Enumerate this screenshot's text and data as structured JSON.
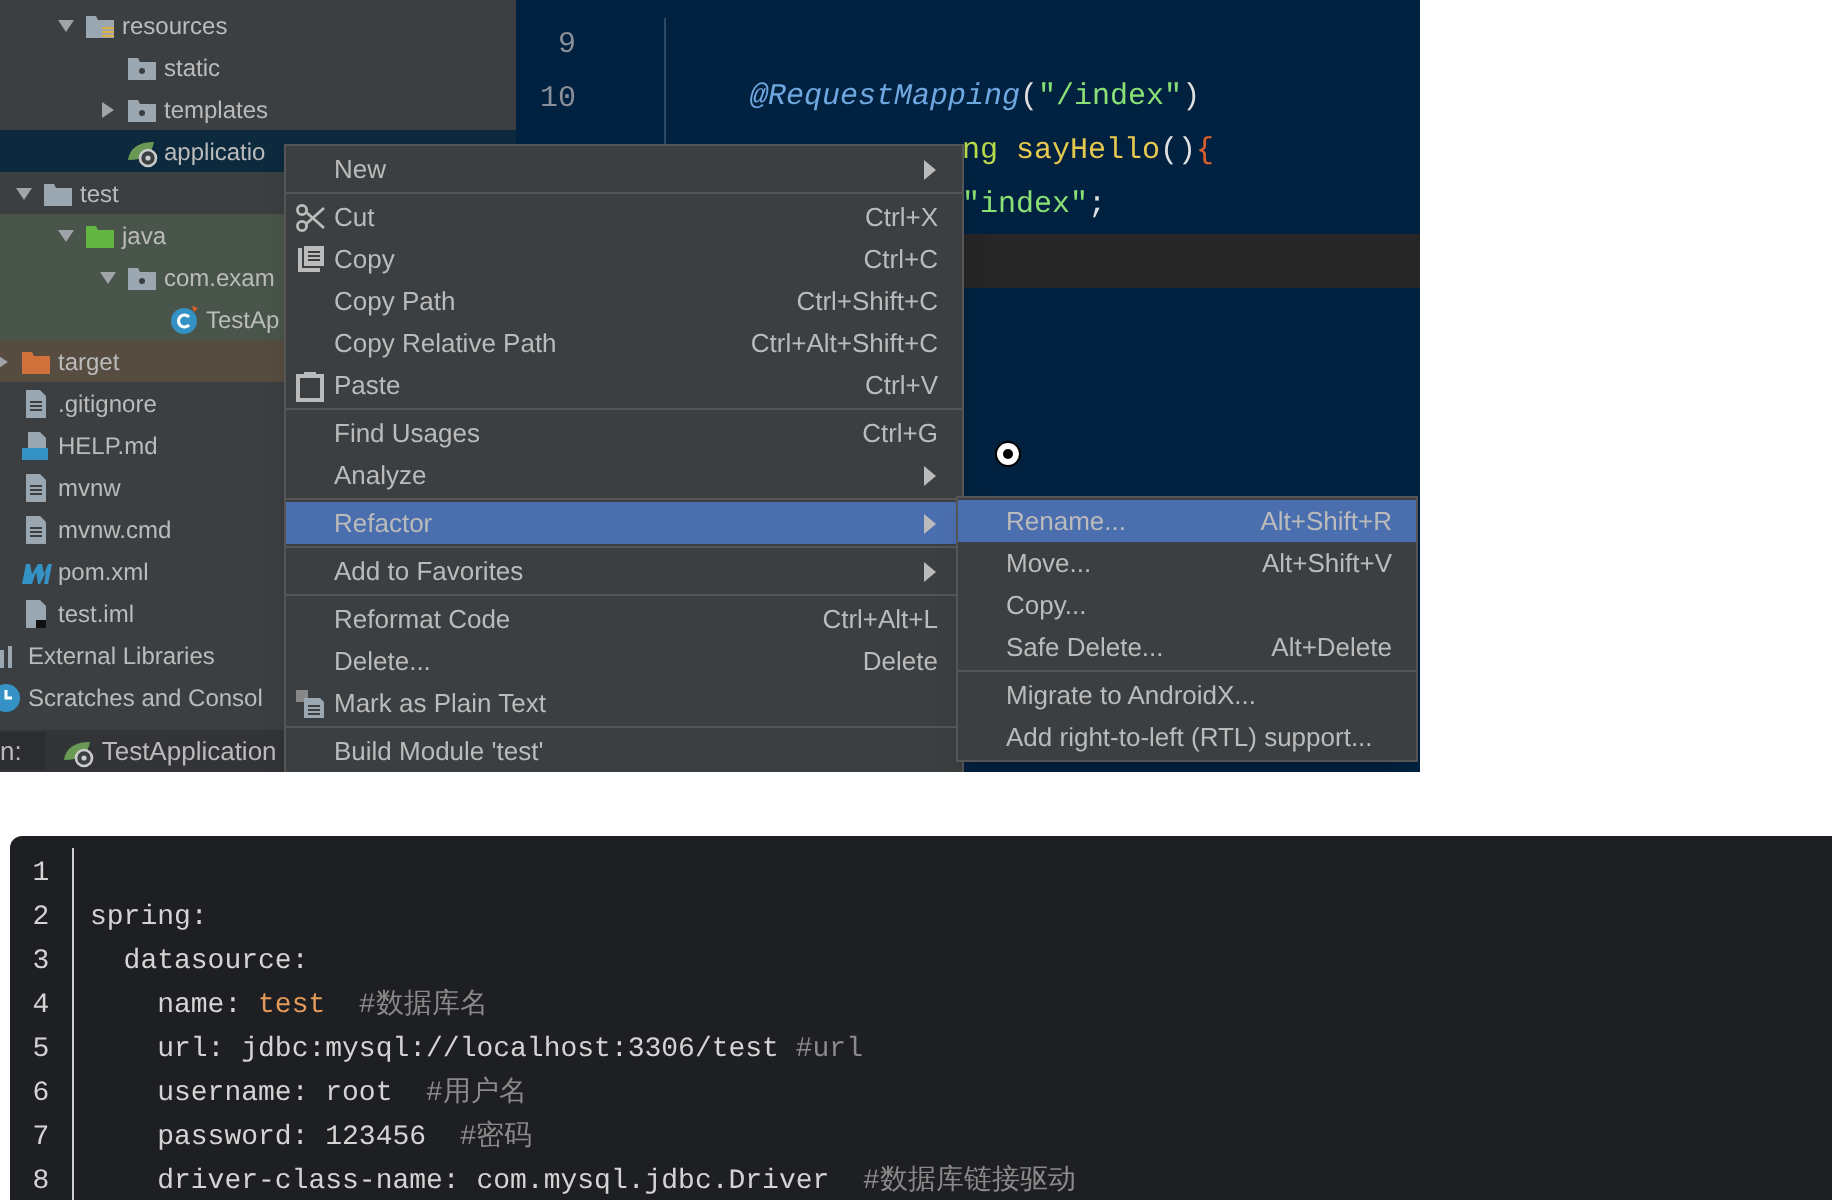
{
  "project_tree": [
    {
      "kind": "offscreen",
      "children": [
        {
          "kind": "offscreen",
          "children": [
            {
              "label": "resources",
              "kind": "resource-folder",
              "expanded": true,
              "selected": false,
              "children": [
                {
                  "label": "static",
                  "kind": "package",
                  "selected": false
                },
                {
                  "label": "templates",
                  "kind": "package",
                  "expanded": false,
                  "selected": false
                },
                {
                  "label": "applicatio",
                  "kind": "spring-config",
                  "selected": true
                }
              ]
            }
          ]
        },
        {
          "label": "test",
          "kind": "folder",
          "expanded": true,
          "selected": false,
          "children": [
            {
              "label": "java",
              "kind": "source-folder",
              "expanded": true,
              "selected": false,
              "color": "#49544a",
              "children": [
                {
                  "label": "com.exam",
                  "kind": "package",
                  "expanded": true,
                  "selected": false,
                  "color": "#49544a",
                  "children": [
                    {
                      "label": "TestAp",
                      "kind": "java-class",
                      "selected": false,
                      "color": "#49544a"
                    }
                  ]
                }
              ]
            }
          ]
        }
      ]
    },
    {
      "label": "target",
      "kind": "excluded-folder",
      "expanded": false,
      "selected": false,
      "color": "#574c40"
    },
    {
      "label": ".gitignore",
      "kind": "file",
      "selected": false
    },
    {
      "label": "HELP.md",
      "kind": "markdown",
      "selected": false
    },
    {
      "label": "mvnw",
      "kind": "file",
      "selected": false
    },
    {
      "label": "mvnw.cmd",
      "kind": "file",
      "selected": false
    },
    {
      "label": "pom.xml",
      "kind": "maven",
      "selected": false
    },
    {
      "label": "test.iml",
      "kind": "module-file",
      "selected": false
    },
    {
      "label": "External Libraries",
      "kind": "libraries",
      "selected": false
    },
    {
      "label": "Scratches and Consol",
      "kind": "scratches",
      "selected": false
    }
  ],
  "run_bar": {
    "label": "n:",
    "config": "TestApplication"
  },
  "editor": {
    "lines": [
      {
        "number": "9",
        "kind": "full"
      },
      {
        "number": "10",
        "kind": "full",
        "tokens": [
          {
            "kind": "annotation",
            "text": "@RequestMapping"
          },
          {
            "kind": "plain",
            "text": "("
          },
          {
            "kind": "string",
            "text": "\"/index\""
          },
          {
            "kind": "plain",
            "text": ")"
          }
        ]
      },
      {
        "kind": "clipped",
        "tokens": [
          {
            "kind": "type",
            "text": "ng"
          },
          {
            "kind": "method",
            "text": " sayHello"
          },
          {
            "kind": "plain",
            "text": "()"
          },
          {
            "kind": "brace",
            "text": "{"
          }
        ]
      },
      {
        "kind": "clipped",
        "tokens": [
          {
            "kind": "string",
            "text": "\"index\""
          },
          {
            "kind": "plain",
            "text": ";"
          }
        ]
      },
      {
        "kind": "current"
      }
    ]
  },
  "context_menu": {
    "groups": [
      [
        {
          "label": "New",
          "kind": "plain",
          "submenu": true,
          "selected": false
        }
      ],
      [
        {
          "label": "Cut",
          "kind": "cut",
          "shortcut": "Ctrl+X",
          "submenu": false,
          "selected": false
        },
        {
          "label": "Copy",
          "kind": "copy",
          "shortcut": "Ctrl+C",
          "submenu": false,
          "selected": false
        },
        {
          "label": "Copy Path",
          "kind": "plain",
          "shortcut": "Ctrl+Shift+C",
          "submenu": false,
          "selected": false
        },
        {
          "label": "Copy Relative Path",
          "kind": "plain",
          "shortcut": "Ctrl+Alt+Shift+C",
          "submenu": false,
          "selected": false
        },
        {
          "label": "Paste",
          "kind": "paste",
          "shortcut": "Ctrl+V",
          "submenu": false,
          "selected": false
        }
      ],
      [
        {
          "label": "Find Usages",
          "kind": "plain",
          "shortcut": "Ctrl+G",
          "submenu": false,
          "selected": false
        },
        {
          "label": "Analyze",
          "kind": "plain",
          "submenu": true,
          "selected": false
        }
      ],
      [
        {
          "label": "Refactor",
          "kind": "plain",
          "submenu": true,
          "selected": true
        }
      ],
      [
        {
          "label": "Add to Favorites",
          "kind": "plain",
          "submenu": true,
          "selected": false
        }
      ],
      [
        {
          "label": "Reformat Code",
          "kind": "plain",
          "shortcut": "Ctrl+Alt+L",
          "submenu": false,
          "selected": false
        },
        {
          "label": "Delete...",
          "kind": "plain",
          "shortcut": "Delete",
          "submenu": false,
          "selected": false
        },
        {
          "label": "Mark as Plain Text",
          "kind": "plaintext",
          "submenu": false,
          "selected": false
        }
      ],
      [
        {
          "label": "Build Module 'test'",
          "kind": "plain",
          "submenu": false,
          "selected": false
        }
      ]
    ]
  },
  "refactor_submenu": {
    "groups": [
      [
        {
          "label": "Rename...",
          "shortcut": "Alt+Shift+R",
          "selected": true
        },
        {
          "label": "Move...",
          "shortcut": "Alt+Shift+V",
          "selected": false
        },
        {
          "label": "Copy...",
          "selected": false
        },
        {
          "label": "Safe Delete...",
          "shortcut": "Alt+Delete",
          "selected": false
        }
      ],
      [
        {
          "label": "Migrate to AndroidX...",
          "selected": false
        },
        {
          "label": "Add right-to-left (RTL) support...",
          "selected": false
        }
      ]
    ]
  },
  "code_block": {
    "lines": [
      {
        "number": "1"
      },
      {
        "number": "2",
        "tokens": [
          {
            "kind": "key",
            "text": "spring:"
          }
        ]
      },
      {
        "number": "3",
        "tokens": [
          {
            "kind": "key",
            "text": "  datasource:"
          }
        ]
      },
      {
        "number": "4",
        "tokens": [
          {
            "kind": "key",
            "text": "    name: "
          },
          {
            "kind": "value",
            "text": "test"
          },
          {
            "kind": "comment",
            "text": "  #数据库名"
          }
        ]
      },
      {
        "number": "5",
        "tokens": [
          {
            "kind": "key",
            "text": "    url: jdbc:mysql://localhost:3306/test "
          },
          {
            "kind": "comment",
            "text": "#url"
          }
        ]
      },
      {
        "number": "6",
        "tokens": [
          {
            "kind": "key",
            "text": "    username: root "
          },
          {
            "kind": "comment",
            "text": " #用户名"
          }
        ]
      },
      {
        "number": "7",
        "tokens": [
          {
            "kind": "key",
            "text": "    password: 123456 "
          },
          {
            "kind": "comment",
            "text": " #密码"
          }
        ]
      },
      {
        "number": "8",
        "tokens": [
          {
            "kind": "key",
            "text": "    driver-class-name: com.mysql.jdbc.Driver "
          },
          {
            "kind": "comment",
            "text": " #数据库链接驱动"
          }
        ]
      }
    ]
  }
}
